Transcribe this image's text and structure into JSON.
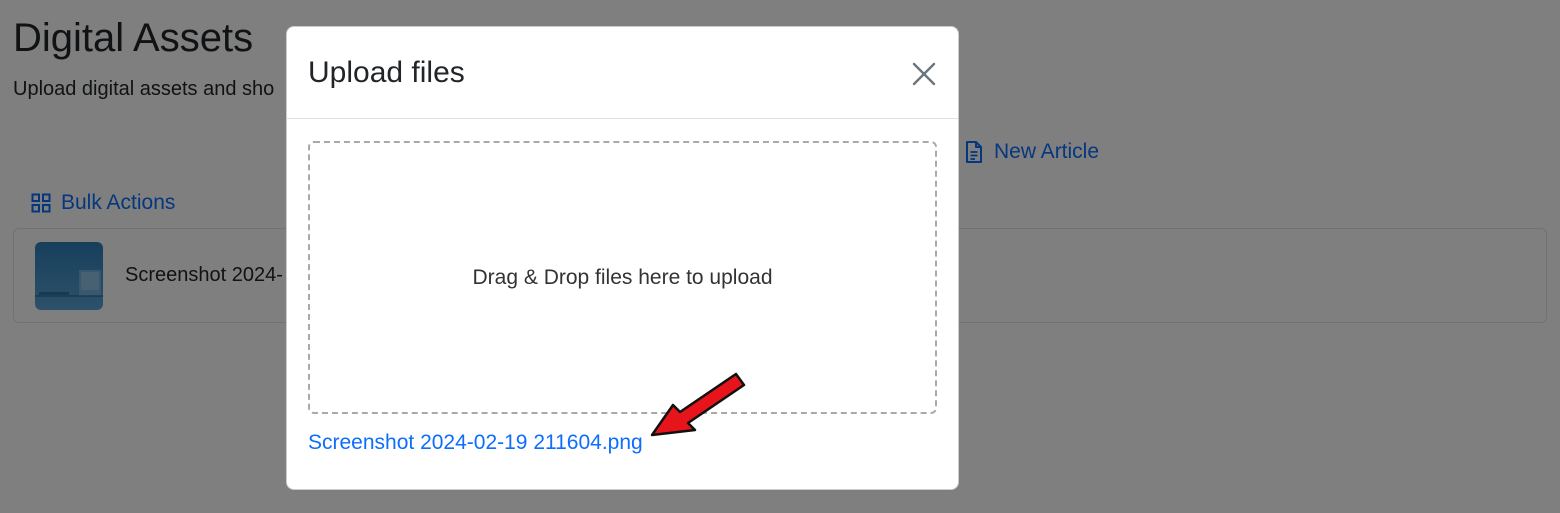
{
  "page": {
    "title": "Digital Assets",
    "subtitle": "Upload digital assets and sho"
  },
  "actions": {
    "new_article_label": "New Article",
    "new_article_icon": "document-icon",
    "bulk_actions_label": "Bulk Actions",
    "bulk_actions_icon": "grid-icon"
  },
  "assets": [
    {
      "name": "Screenshot 2024-"
    }
  ],
  "modal": {
    "title": "Upload files",
    "close_icon": "close-icon",
    "dropzone_text": "Drag & Drop files here to upload",
    "uploaded_files": [
      {
        "name": "Screenshot 2024-02-19 211604.png"
      }
    ]
  },
  "annotation": {
    "arrow_color": "#e8141b"
  },
  "colors": {
    "link": "#0d6efd",
    "backdrop": "rgba(0,0,0,0.5)",
    "border": "#dee2e6"
  }
}
